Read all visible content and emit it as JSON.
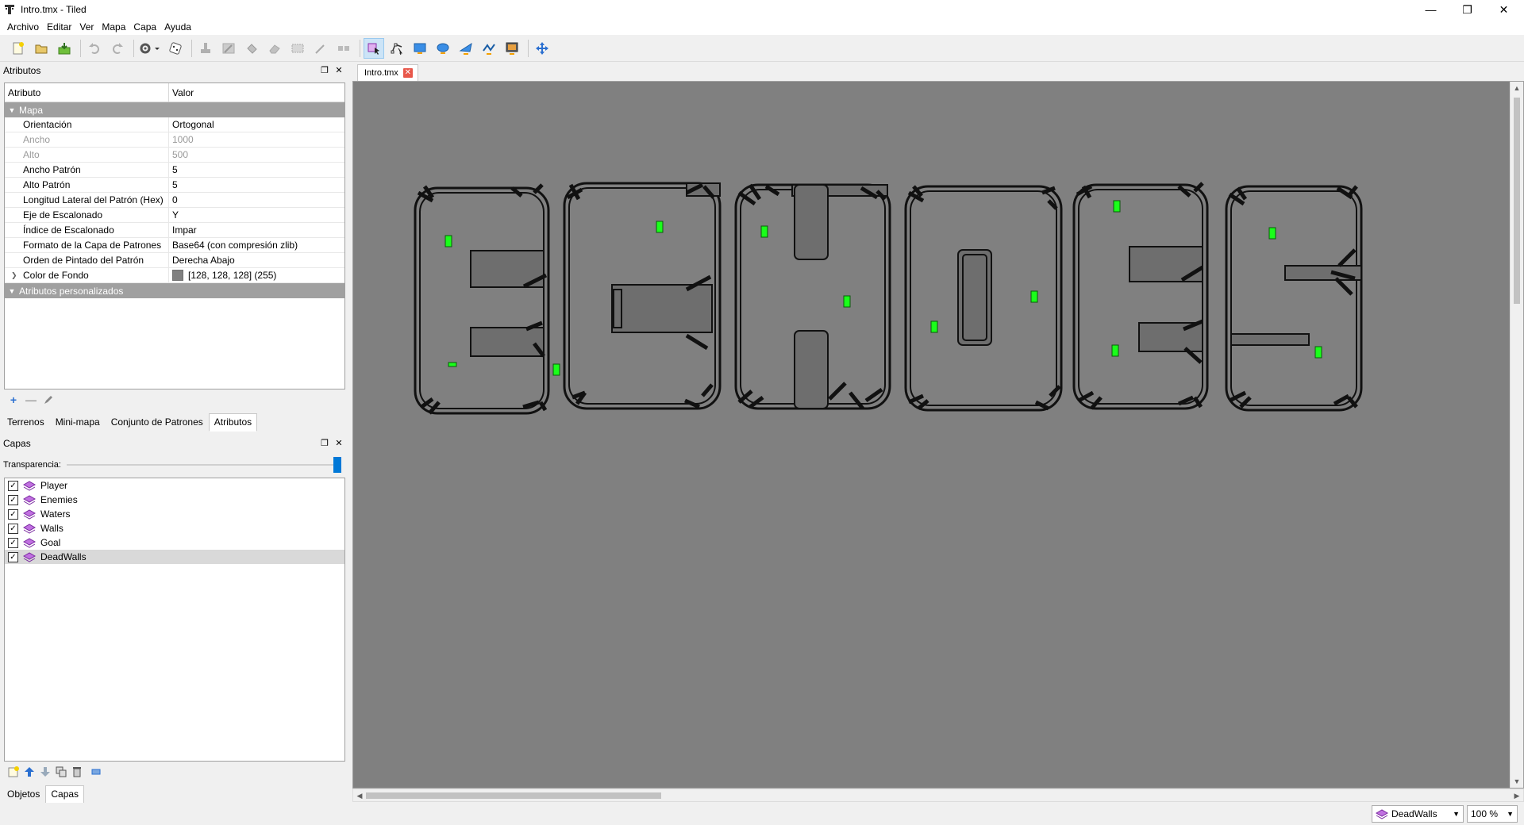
{
  "window": {
    "title": "Intro.tmx - Tiled"
  },
  "menu": [
    "Archivo",
    "Editar",
    "Ver",
    "Mapa",
    "Capa",
    "Ayuda"
  ],
  "toolbar": {
    "buttons": [
      "new-map",
      "open",
      "save",
      "undo",
      "redo",
      "commands",
      "random-mode",
      "stamp-brush",
      "terrain-brush",
      "bucket-fill",
      "eraser",
      "rect-select",
      "magic-wand",
      "select-same-tile",
      "select-objects",
      "edit-polygons",
      "insert-rectangle",
      "insert-ellipse",
      "insert-polygon",
      "insert-polyline",
      "insert-tile",
      "move"
    ]
  },
  "properties_panel": {
    "title": "Atributos",
    "columns": {
      "name": "Atributo",
      "value": "Valor"
    },
    "group_map": "Mapa",
    "rows": [
      {
        "k": "Orientación",
        "v": "Ortogonal",
        "dim": false
      },
      {
        "k": "Ancho",
        "v": "1000",
        "dim": true
      },
      {
        "k": "Alto",
        "v": "500",
        "dim": true
      },
      {
        "k": "Ancho Patrón",
        "v": "5",
        "dim": false
      },
      {
        "k": "Alto Patrón",
        "v": "5",
        "dim": false
      },
      {
        "k": "Longitud Lateral del Patrón (Hex)",
        "v": "0",
        "dim": false
      },
      {
        "k": "Eje de Escalonado",
        "v": "Y",
        "dim": false
      },
      {
        "k": "Índice de Escalonado",
        "v": "Impar",
        "dim": false
      },
      {
        "k": "Formato de la Capa de Patrones",
        "v": "Base64 (con compresión zlib)",
        "dim": false
      },
      {
        "k": "Orden de Pintado del Patrón",
        "v": "Derecha Abajo",
        "dim": false
      }
    ],
    "bg_color": {
      "k": "Color de Fondo",
      "v": "[128, 128, 128] (255)",
      "swatch": "#808080"
    },
    "group_custom": "Atributos personalizados",
    "tabs": [
      "Terrenos",
      "Mini-mapa",
      "Conjunto de Patrones",
      "Atributos"
    ],
    "active_tab": "Atributos"
  },
  "layers_panel": {
    "title": "Capas",
    "opacity_label": "Transparencia:",
    "opacity_value": 1.0,
    "layers": [
      "Player",
      "Enemies",
      "Waters",
      "Walls",
      "Goal",
      "DeadWalls"
    ],
    "selected": "DeadWalls",
    "tabs": [
      "Objetos",
      "Capas"
    ],
    "active_tab": "Capas"
  },
  "document": {
    "tab": "Intro.tmx"
  },
  "status": {
    "layer": "DeadWalls",
    "zoom": "100 %"
  },
  "colors": {
    "canvas_bg": "#808080",
    "object_fill": "#606060",
    "goal": "#1aff1a",
    "selection": "#cce4f7"
  }
}
